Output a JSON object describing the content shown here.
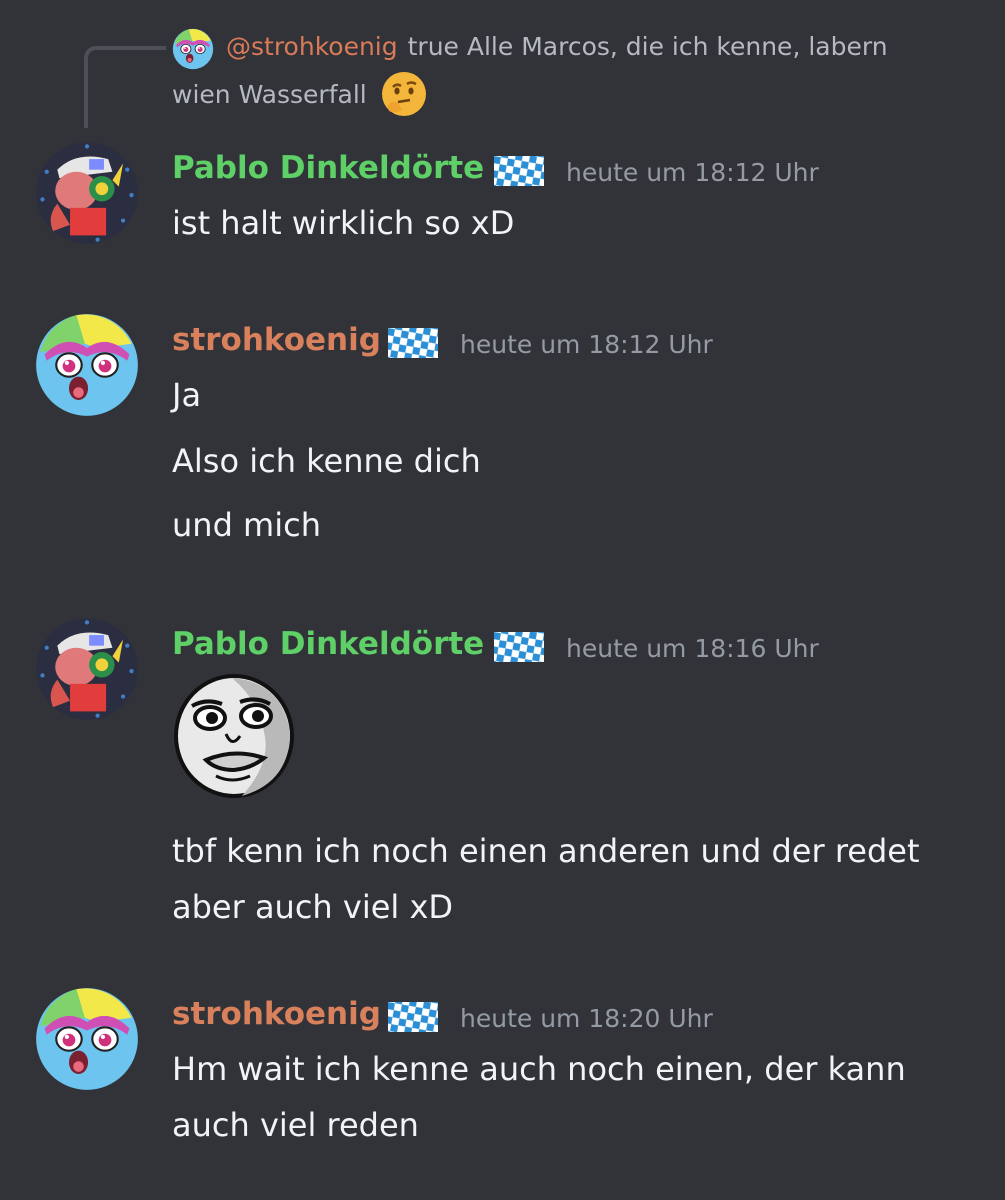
{
  "reply": {
    "mention": "@strohkoenig",
    "text_line1": "true Alle Marcos, die ich kenne, labern",
    "text_line2": "wien Wasserfall",
    "emoji": "thinking-face-icon"
  },
  "messages": [
    {
      "author": "Pablo Dinkeldörte",
      "author_color": "#5fd068",
      "timestamp": "heute um 18:12 Uhr",
      "lines": [
        "ist halt wirklich so xD"
      ]
    },
    {
      "author": "strohkoenig",
      "author_color": "#d9805d",
      "timestamp": "heute um 18:12 Uhr",
      "lines": [
        "Ja",
        "Also ich kenne dich",
        "und mich"
      ]
    },
    {
      "author": "Pablo Dinkeldörte",
      "author_color": "#5fd068",
      "timestamp": "heute um 18:16 Uhr",
      "sticker": "staring-meme-face",
      "lines": [
        "tbf kenn ich noch einen anderen und der redet",
        "aber auch viel xD"
      ]
    },
    {
      "author": "strohkoenig",
      "author_color": "#d9805d",
      "timestamp": "heute um 18:20 Uhr",
      "lines": [
        "Hm wait ich kenne auch noch einen, der kann",
        "auch viel reden"
      ]
    }
  ],
  "colors": {
    "background": "#313338",
    "timestamp": "#949ba4",
    "message_text": "#f2f3f5"
  }
}
